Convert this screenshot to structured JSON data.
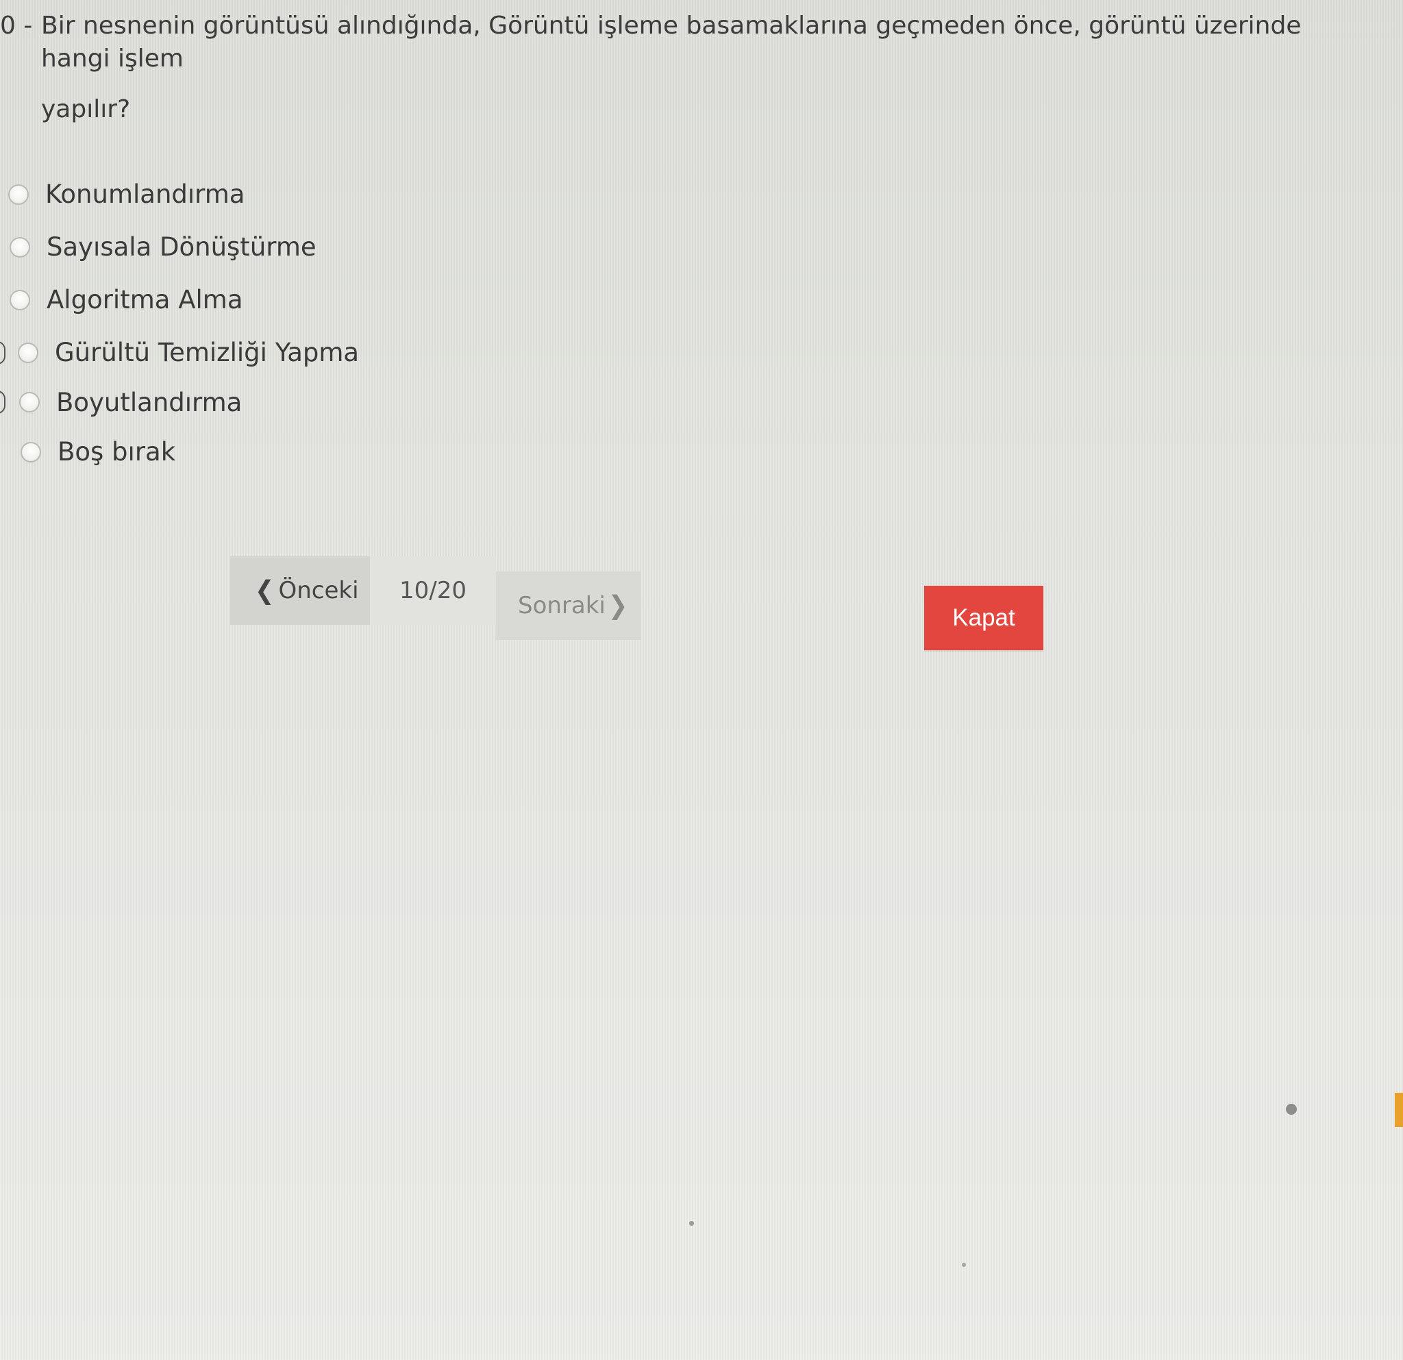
{
  "question": {
    "number": "0 -",
    "text_line1": "Bir nesnenin görüntüsü alındığında, Görüntü işleme basamaklarına geçmeden önce, görüntü üzerinde hangi işlem",
    "text_line2": "yapılır?"
  },
  "options": [
    {
      "label": "Konumlandırma",
      "selected": false
    },
    {
      "label": "Sayısala Dönüştürme",
      "selected": false
    },
    {
      "label": "Algoritma Alma",
      "selected": false
    },
    {
      "label": "Gürültü Temizliği Yapma",
      "selected": false
    },
    {
      "label": "Boyutlandırma",
      "selected": false
    },
    {
      "label": "Boş bırak",
      "selected": false
    }
  ],
  "navigation": {
    "prev_label": "Önceki",
    "page_indicator": "10/20",
    "next_label": "Sonraki"
  },
  "close_button": {
    "label": "Kapat"
  },
  "colors": {
    "close_button_bg": "#e2463f",
    "background": "#e6e6e2"
  }
}
